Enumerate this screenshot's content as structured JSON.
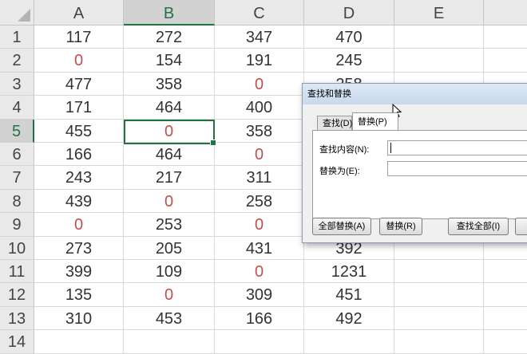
{
  "columns": [
    "A",
    "B",
    "C",
    "D",
    "E"
  ],
  "rows": [
    "1",
    "2",
    "3",
    "4",
    "5",
    "6",
    "7",
    "8",
    "9",
    "10",
    "11",
    "12",
    "13",
    "14"
  ],
  "active_cell": {
    "col": "B",
    "row": "5"
  },
  "cells": [
    [
      "117",
      "272",
      "347",
      "470"
    ],
    [
      "0",
      "154",
      "191",
      "245"
    ],
    [
      "477",
      "358",
      "0",
      "258"
    ],
    [
      "171",
      "464",
      "400",
      ""
    ],
    [
      "455",
      "0",
      "358",
      ""
    ],
    [
      "166",
      "464",
      "0",
      ""
    ],
    [
      "243",
      "217",
      "311",
      ""
    ],
    [
      "439",
      "0",
      "258",
      ""
    ],
    [
      "0",
      "253",
      "0",
      ""
    ],
    [
      "273",
      "205",
      "431",
      "392"
    ],
    [
      "399",
      "109",
      "0",
      "1231"
    ],
    [
      "135",
      "0",
      "309",
      "451"
    ],
    [
      "310",
      "453",
      "166",
      "492"
    ],
    [
      "",
      "",
      "",
      ""
    ]
  ],
  "colors": {
    "zero_text": "#c0504d",
    "selection": "#217346"
  },
  "dialog": {
    "title": "查找和替换",
    "tab_find": "查找(D)",
    "tab_replace": "替换(P)",
    "find_label": "查找内容(N):",
    "replace_label": "替换为(E):",
    "find_value": "",
    "replace_value": "",
    "btn_replace_all": "全部替换(A)",
    "btn_replace": "替换(R)",
    "btn_find_all": "查找全部(I)",
    "btn_find_next": "查"
  }
}
